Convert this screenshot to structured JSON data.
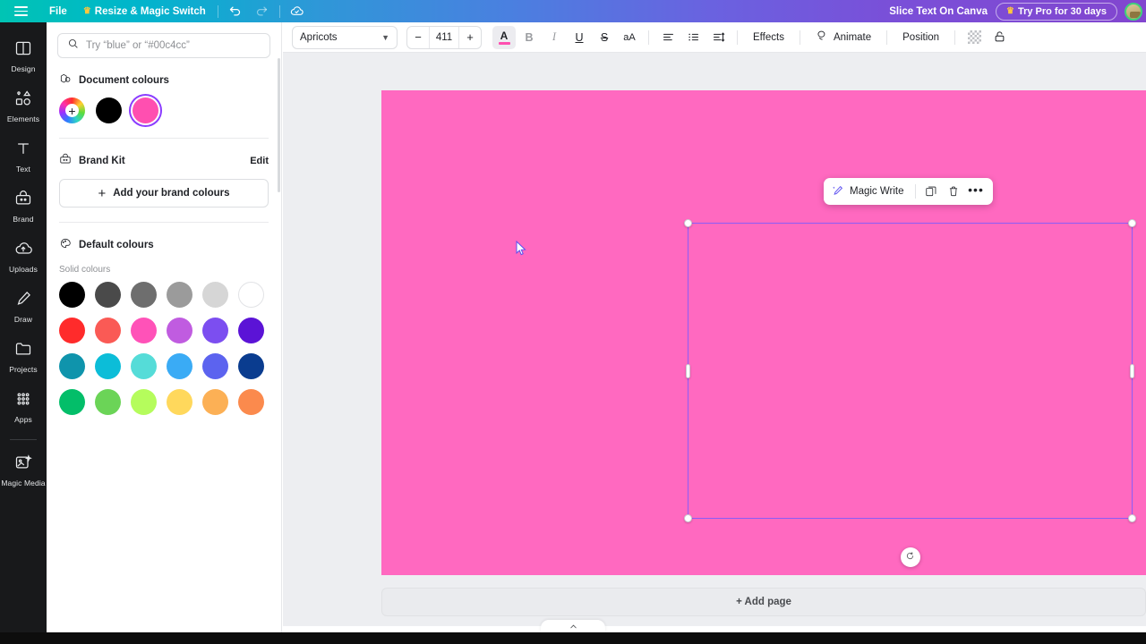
{
  "topbar": {
    "menu_icon": "hamburger-icon",
    "file_label": "File",
    "resize_label": "Resize & Magic Switch",
    "resize_crown": "♛",
    "undo_icon": "undo-icon",
    "redo_icon": "redo-icon",
    "saved_icon": "cloud-check-icon",
    "project_title": "Slice Text On Canva",
    "pro_label": "Try Pro for 30 days",
    "pro_crown": "♛",
    "avatar": "user-avatar"
  },
  "rail": {
    "items": [
      {
        "label": "Design",
        "icon": "design-icon"
      },
      {
        "label": "Elements",
        "icon": "elements-icon"
      },
      {
        "label": "Text",
        "icon": "text-icon"
      },
      {
        "label": "Brand",
        "icon": "brand-icon"
      },
      {
        "label": "Uploads",
        "icon": "uploads-icon"
      },
      {
        "label": "Draw",
        "icon": "draw-icon"
      },
      {
        "label": "Projects",
        "icon": "projects-icon"
      },
      {
        "label": "Apps",
        "icon": "apps-icon"
      }
    ],
    "bottom_items": [
      {
        "label": "Magic Media",
        "icon": "magic-media-icon"
      }
    ]
  },
  "panel": {
    "search": {
      "placeholder": "Try “blue” or “#00c4cc”",
      "value": "",
      "icon": "search-icon"
    },
    "document_colours": {
      "title": "Document colours",
      "icon": "document-colours-icon",
      "swatches": [
        {
          "name": "add-colour",
          "type": "rainbow",
          "hex": ""
        },
        {
          "name": "black",
          "type": "solid",
          "hex": "#000000",
          "selected": false
        },
        {
          "name": "pink",
          "type": "solid",
          "hex": "#ff4fb0",
          "selected": true
        }
      ]
    },
    "brand_kit": {
      "title": "Brand Kit",
      "icon": "brand-kit-icon",
      "edit_label": "Edit",
      "add_label": "Add your brand colours"
    },
    "default_colours": {
      "title": "Default colours",
      "icon": "palette-icon",
      "sub_label": "Solid colours",
      "rows": [
        [
          "#000000",
          "#4a4a4a",
          "#6e6e6e",
          "#9b9b9b",
          "#d6d6d6",
          "#ffffff"
        ],
        [
          "#ff2b2b",
          "#fa5a55",
          "#ff52b8",
          "#c05ce0",
          "#7c4ef0",
          "#5b13d6"
        ],
        [
          "#0f94ac",
          "#0cbdd8",
          "#55dcd8",
          "#3aabf5",
          "#5c63ef",
          "#0a3c8f"
        ],
        [
          "#03be69",
          "#6bd457",
          "#b5fc5c",
          "#ffd85c",
          "#fcb055",
          "#fb8a4d"
        ]
      ]
    }
  },
  "toolbar": {
    "font_name": "Apricots",
    "font_chevron": "chevron-down-icon",
    "size_minus": "−",
    "size_value": "411",
    "size_plus": "+",
    "text_colour_letter": "A",
    "text_colour_hex": "#ff4fb0",
    "bold_label": "B",
    "italic_label": "I",
    "underline_label": "U",
    "strikethrough_label": "S",
    "case_label": "aA",
    "align_icon": "align-left-icon",
    "list_icon": "bullet-list-icon",
    "spacing_icon": "line-spacing-icon",
    "effects_label": "Effects",
    "animate_label": "Animate",
    "animate_icon": "animate-icon",
    "position_label": "Position",
    "transparency_icon": "transparency-icon",
    "lock_icon": "lock-icon"
  },
  "canvas": {
    "background_hex": "#ff69c0",
    "selection_colour": "#8b5cf6",
    "rotate_icon": "rotate-icon",
    "cursor_icon": "mouse-cursor",
    "float_toolbar": {
      "magic_write_label": "Magic Write",
      "magic_write_icon": "magic-wand-icon",
      "duplicate_icon": "duplicate-icon",
      "delete_icon": "trash-icon",
      "more_icon": "more-options-icon",
      "more_label": "•••"
    }
  },
  "footer": {
    "add_page_label": "+ Add page",
    "expand_icon": "chevron-up-icon"
  }
}
